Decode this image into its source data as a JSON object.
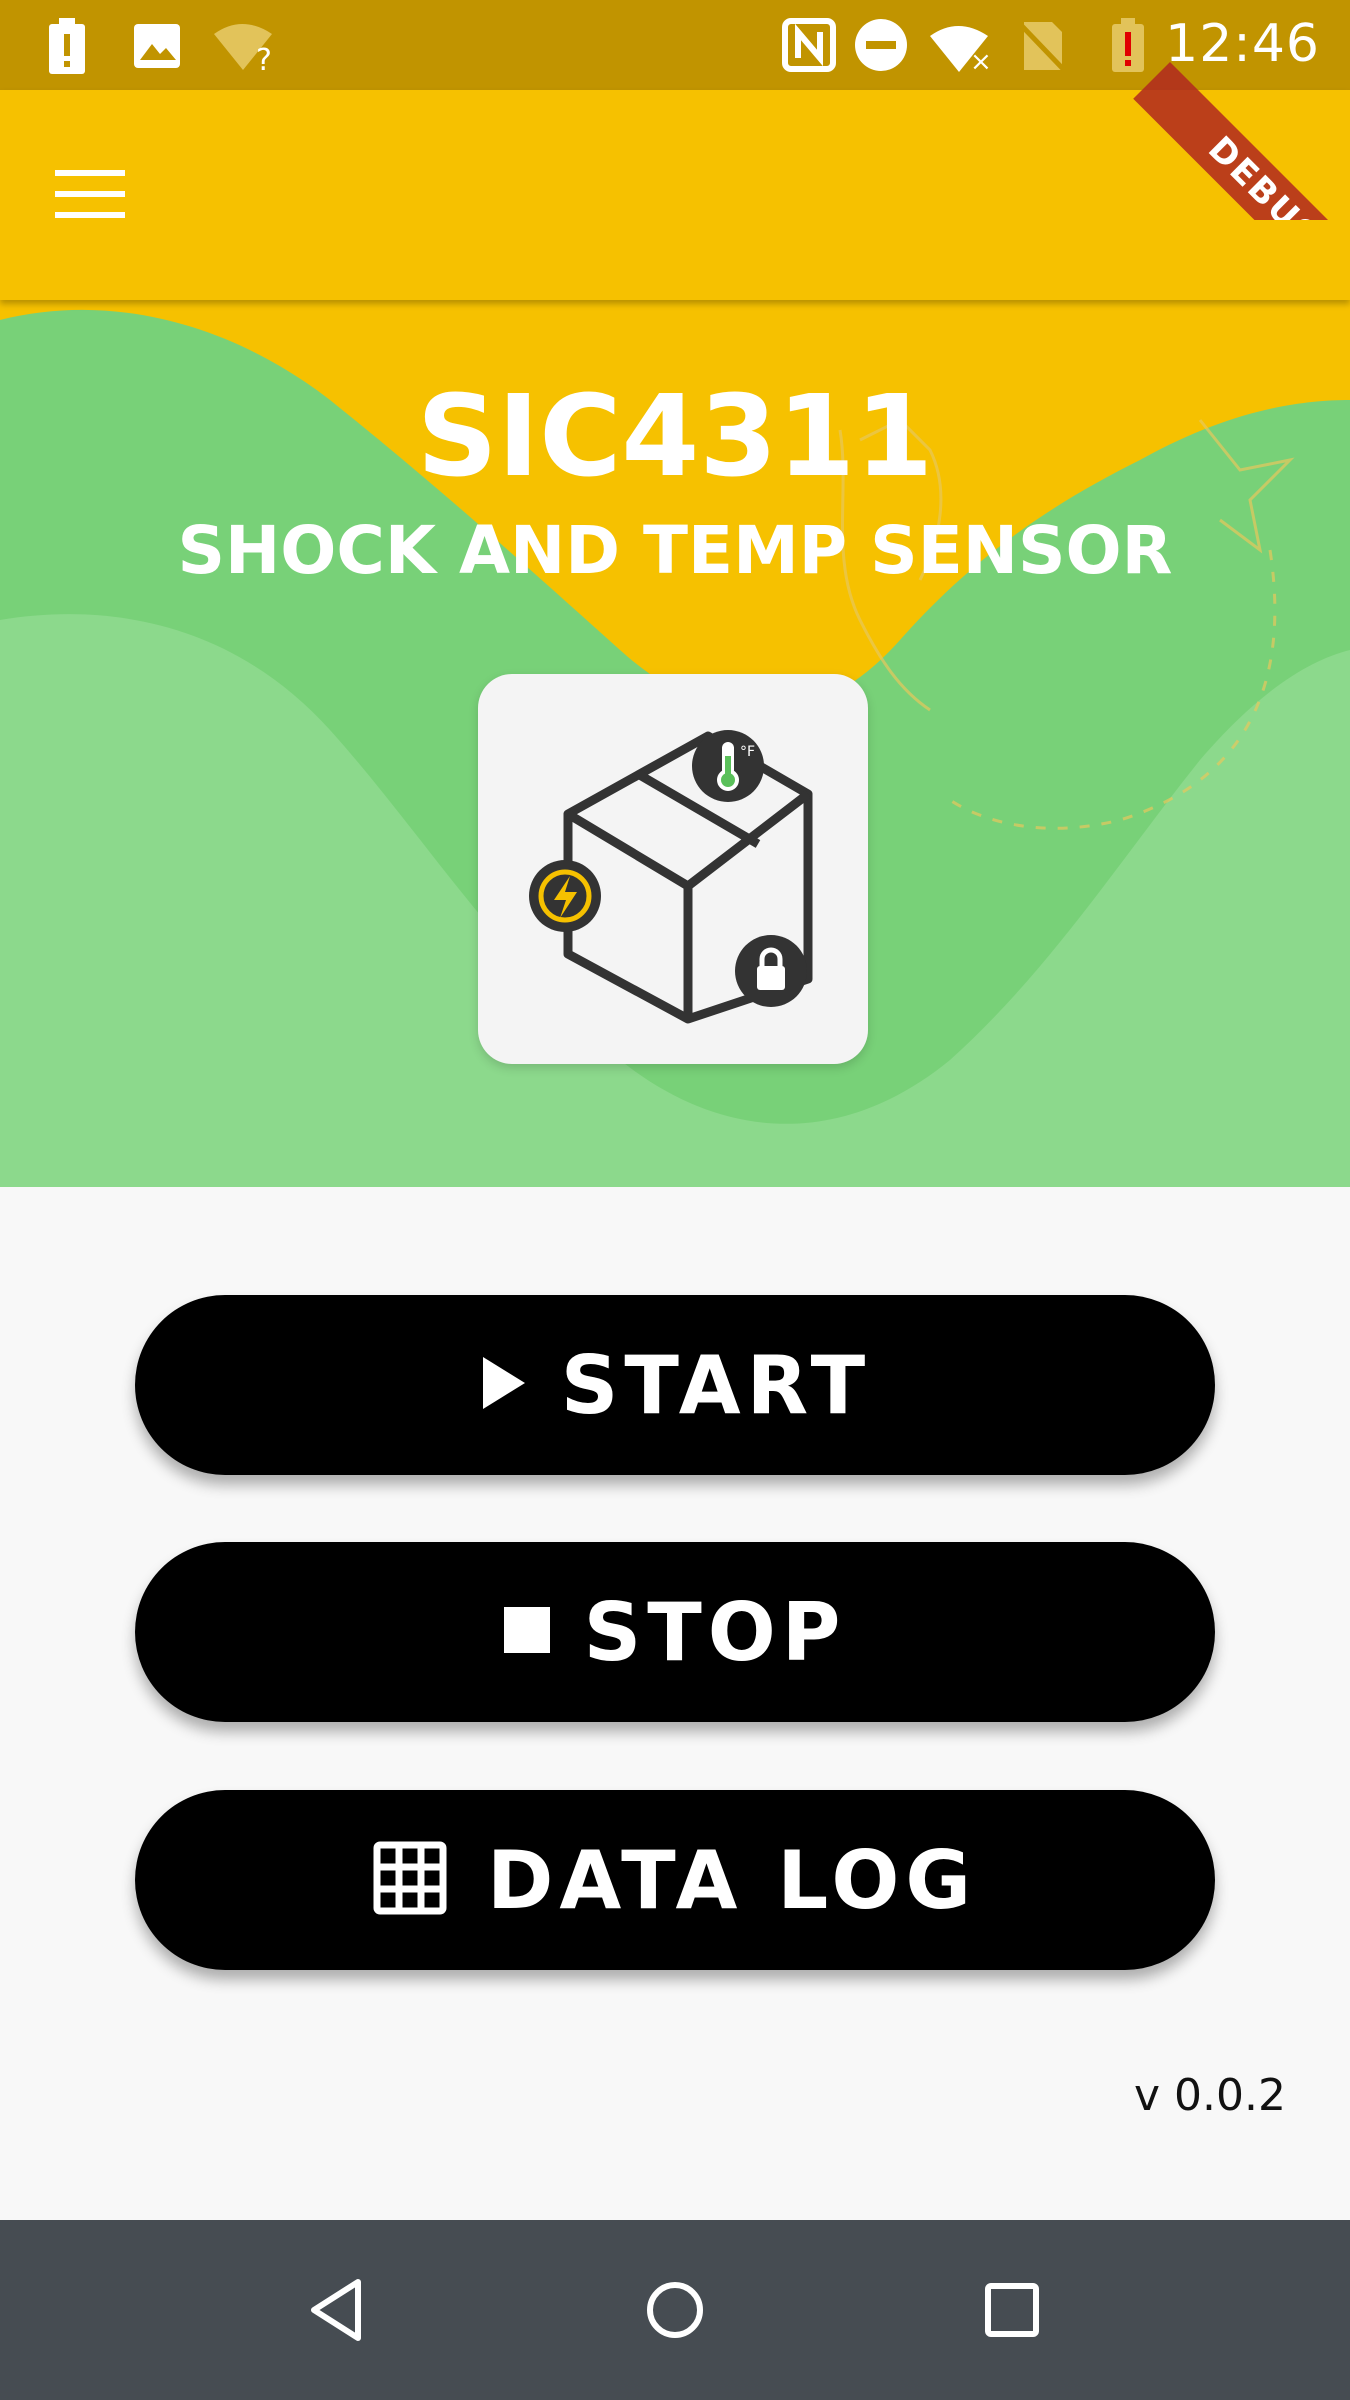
{
  "status_bar": {
    "time": "12:46",
    "icons": [
      "battery-alert-icon",
      "image-icon",
      "wifi-question-icon",
      "nfc-icon",
      "do-not-disturb-icon",
      "wifi-x-icon",
      "no-sim-icon",
      "battery-low-alert-icon"
    ]
  },
  "debug_banner": "DEBUG",
  "app_bar": {
    "menu_icon": "hamburger-menu-icon"
  },
  "hero": {
    "title": "SIC4311",
    "subtitle": "SHOCK AND TEMP SENSOR",
    "logo_icons": [
      "box-icon",
      "thermometer-icon",
      "shock-icon",
      "lock-icon"
    ],
    "colors": {
      "yellow": "#f6c100",
      "green": "#78d178",
      "light_green": "#8cd98c"
    }
  },
  "buttons": {
    "start": {
      "label": "START",
      "icon": "play-icon"
    },
    "stop": {
      "label": "STOP",
      "icon": "stop-icon"
    },
    "data_log": {
      "label": "DATA LOG",
      "icon": "grid-icon"
    }
  },
  "version": "v 0.0.2",
  "nav_bar": {
    "icons": [
      "back-icon",
      "home-icon",
      "recents-icon"
    ]
  }
}
